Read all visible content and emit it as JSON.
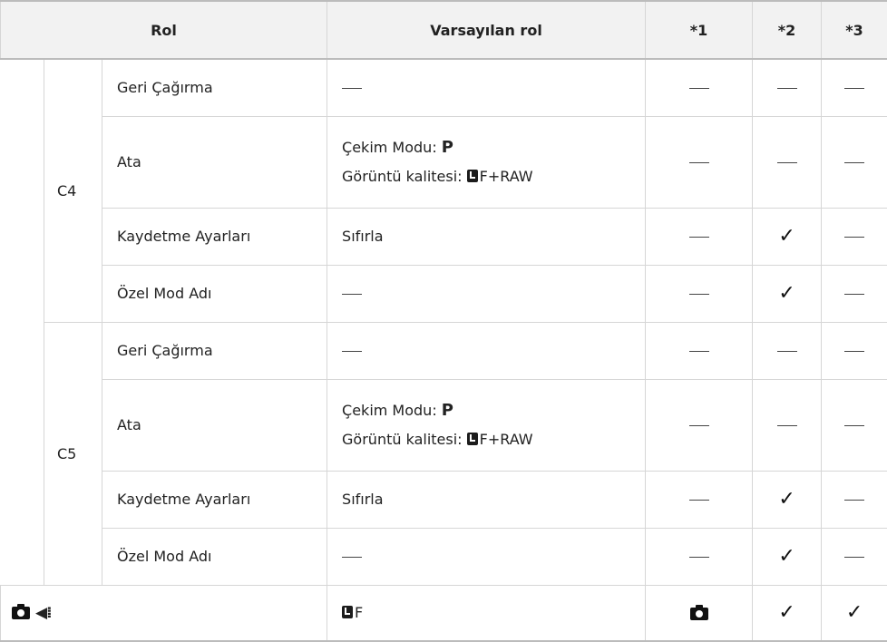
{
  "header": {
    "role": "Rol",
    "default_role": "Varsayılan rol",
    "col1": "*1",
    "col2": "*2",
    "col3": "*3"
  },
  "groups": [
    {
      "label": "C4",
      "rows": [
        {
          "label": "Geri Çağırma",
          "default": "",
          "m1": "dash",
          "m2": "dash",
          "m3": "dash"
        },
        {
          "label": "Ata",
          "default_line1": "Çekim Modu: ",
          "default_line1_bold": "P",
          "default_line2": "Görüntü kalitesi: ",
          "default_line2_suffix": "F+RAW",
          "m1": "dash",
          "m2": "dash",
          "m3": "dash"
        },
        {
          "label": "Kaydetme Ayarları",
          "default": "Sıfırla",
          "m1": "dash",
          "m2": "check",
          "m3": "dash"
        },
        {
          "label": "Özel Mod Adı",
          "default": "",
          "m1": "dash",
          "m2": "check",
          "m3": "dash"
        }
      ]
    },
    {
      "label": "C5",
      "rows": [
        {
          "label": "Geri Çağırma",
          "default": "",
          "m1": "dash",
          "m2": "dash",
          "m3": "dash"
        },
        {
          "label": "Ata",
          "default_line1": "Çekim Modu: ",
          "default_line1_bold": "P",
          "default_line2": "Görüntü kalitesi: ",
          "default_line2_suffix": "F+RAW",
          "m1": "dash",
          "m2": "dash",
          "m3": "dash"
        },
        {
          "label": "Kaydetme Ayarları",
          "default": "Sıfırla",
          "m1": "dash",
          "m2": "check",
          "m3": "dash"
        },
        {
          "label": "Özel Mod Adı",
          "default": "",
          "m1": "dash",
          "m2": "check",
          "m3": "dash"
        }
      ]
    }
  ],
  "footer_row": {
    "icons": [
      "camera-icon",
      "sequential-shooting-icon"
    ],
    "default_suffix": "F",
    "m1": "camera",
    "m2": "check",
    "m3": "check"
  },
  "symbols": {
    "check": "✓"
  }
}
